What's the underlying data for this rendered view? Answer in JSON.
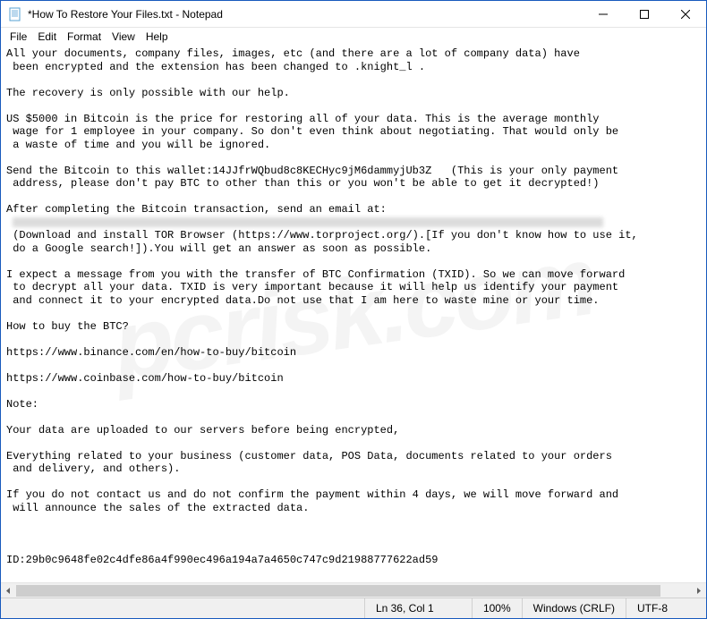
{
  "titlebar": {
    "title": "*How To Restore Your Files.txt - Notepad"
  },
  "menu": {
    "file": "File",
    "edit": "Edit",
    "format": "Format",
    "view": "View",
    "help": "Help"
  },
  "content": {
    "l1": "All your documents, company files, images, etc (and there are a lot of company data) have",
    "l2": " been encrypted and the extension has been changed to .knight_l .",
    "l3": "",
    "l4": "The recovery is only possible with our help.",
    "l5": "",
    "l6": "US $5000 in Bitcoin is the price for restoring all of your data. This is the average monthly",
    "l7": " wage for 1 employee in your company. So don't even think about negotiating. That would only be",
    "l8": " a waste of time and you will be ignored.",
    "l9": "",
    "l10": "Send the Bitcoin to this wallet:14JJfrWQbud8c8KECHyc9jM6dammyjUb3Z   (This is your only payment",
    "l11": " address, please don't pay BTC to other than this or you won't be able to get it decrypted!)",
    "l12": "",
    "l13": "After completing the Bitcoin transaction, send an email at:",
    "l15": " (Download and install TOR Browser (https://www.torproject.org/).[If you don't know how to use it,",
    "l16": " do a Google search!]).You will get an answer as soon as possible.",
    "l17": "",
    "l18": "I expect a message from you with the transfer of BTC Confirmation (TXID). So we can move forward",
    "l19": " to decrypt all your data. TXID is very important because it will help us identify your payment",
    "l20": " and connect it to your encrypted data.Do not use that I am here to waste mine or your time.",
    "l21": "",
    "l22": "How to buy the BTC?",
    "l23": "",
    "l24": "https://www.binance.com/en/how-to-buy/bitcoin",
    "l25": "",
    "l26": "https://www.coinbase.com/how-to-buy/bitcoin",
    "l27": "",
    "l28": "Note:",
    "l29": "",
    "l30": "Your data are uploaded to our servers before being encrypted,",
    "l31": "",
    "l32": "Everything related to your business (customer data, POS Data, documents related to your orders",
    "l33": " and delivery, and others).",
    "l34": "",
    "l35": "If you do not contact us and do not confirm the payment within 4 days, we will move forward and",
    "l36": " will announce the sales of the extracted data.",
    "l37": "",
    "l38": "",
    "l39": "",
    "l40": "ID:29b0c9648fe02c4dfe86a4f990ec496a194a7a4650c747c9d21988777622ad59"
  },
  "statusbar": {
    "position": "Ln 36, Col 1",
    "zoom": "100%",
    "line_ending": "Windows (CRLF)",
    "encoding": "UTF-8"
  },
  "watermark": "pcrisk.com"
}
